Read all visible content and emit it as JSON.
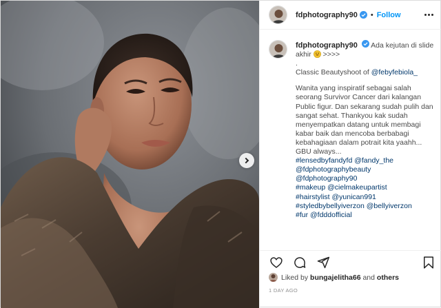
{
  "account": {
    "username": "fdphotography90",
    "follow_label": "Follow",
    "separator": "•"
  },
  "caption": {
    "username": "fdphotography90",
    "intro": "Ada kejutan di slide akhir",
    "intro_suffix": " >>>>",
    "dot": ".",
    "classic_prefix": "Classic Beautyshoot of ",
    "classic_mention": "@febyfebiola_",
    "body": "Wanita yang inspiratif sebagai salah seorang Survivor Cancer dari kalangan Public figur. Dan sekarang sudah pulih dan sangat sehat. Thankyou kak sudah menyempatkan datang untuk membagi kabar baik dan mencoba berbabagi kebahagiaan dalam potrait kita yaahh...",
    "signoff": "GBU always...",
    "tags": [
      "#lensedbyfandyfd @fandy_the",
      "@fdphotographybeauty",
      "@fdphotography90",
      "#makeup @cielmakeupartist",
      "#hairstylist @yunican991",
      "#styledbybellyiverzon @bellyiverzon",
      "#fur @fdddofficial"
    ]
  },
  "likes": {
    "prefix": "Liked by ",
    "user": "bungajelitha66",
    "middle": " and ",
    "others": "others"
  },
  "timestamp": "1 DAY AGO",
  "icons": {
    "like": "heart-icon",
    "comment": "comment-icon",
    "share": "share-icon",
    "save": "bookmark-icon",
    "verified": "verified-badge-icon",
    "next": "chevron-right-icon",
    "more": "more-options-icon"
  },
  "colors": {
    "accent": "#0095f6",
    "link": "#00376b",
    "muted": "#8e8e8e",
    "verified": "#3897f0"
  }
}
